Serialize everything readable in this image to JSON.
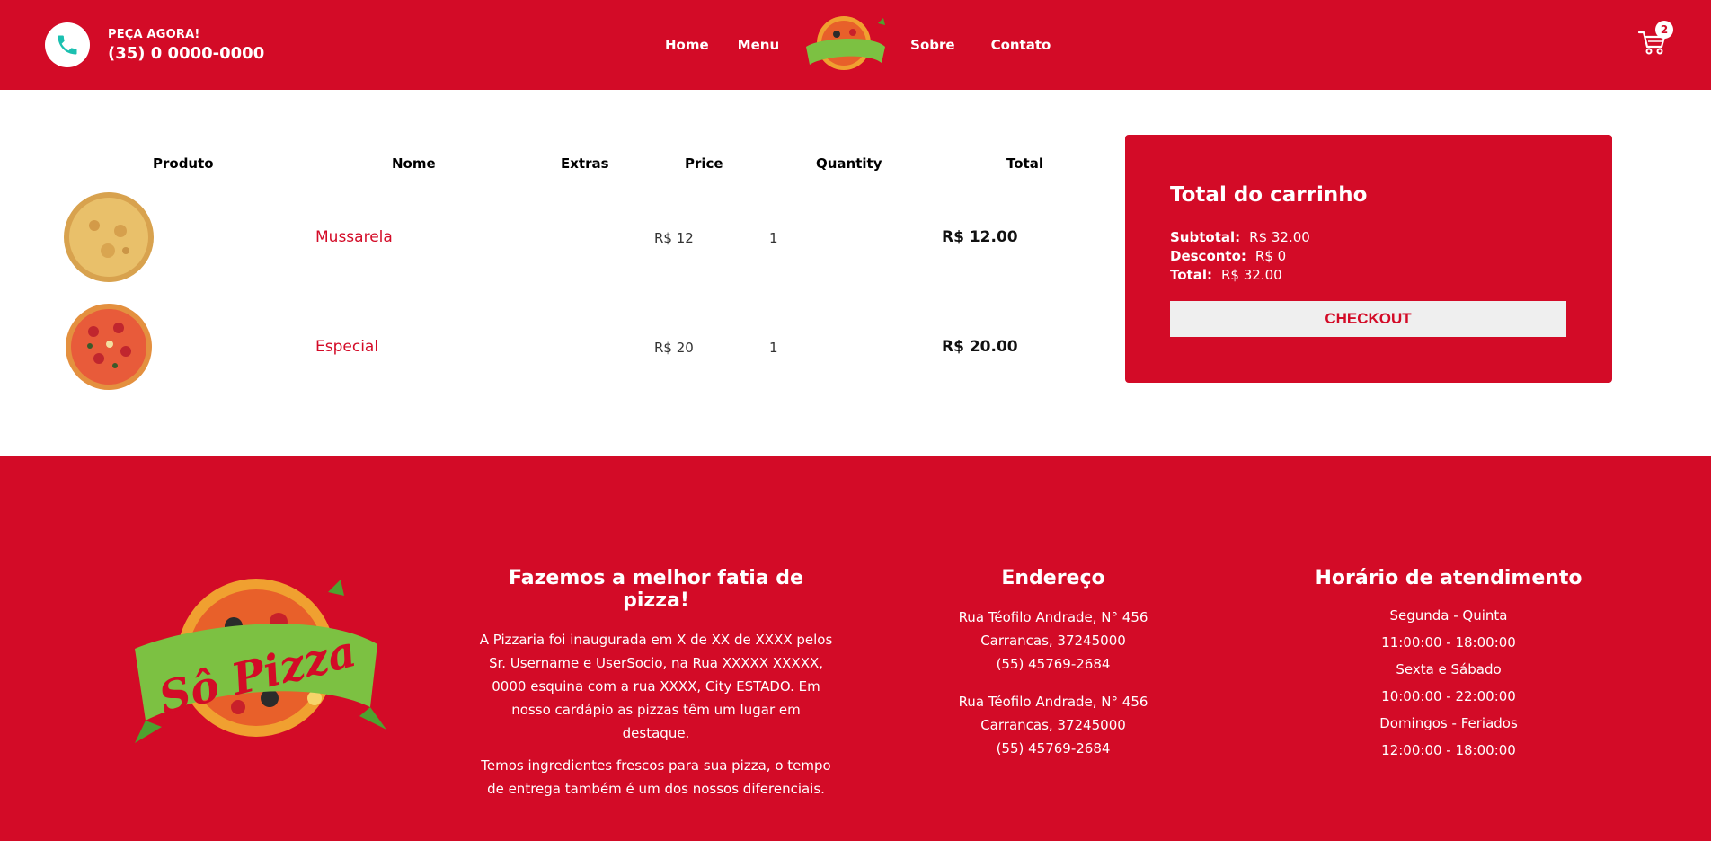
{
  "header": {
    "call_label": "PEÇA AGORA!",
    "call_number": "(35) 0 0000-0000",
    "nav": [
      "Home",
      "Menu",
      "Sobre",
      "Contato"
    ],
    "cart_count": "2"
  },
  "table": {
    "headers": [
      "Produto",
      "Nome",
      "Extras",
      "Price",
      "Quantity",
      "Total"
    ],
    "rows": [
      {
        "name": "Mussarela",
        "extras": "",
        "price": "R$ 12",
        "quantity": "1",
        "total": "R$ 12.00"
      },
      {
        "name": "Especial",
        "extras": "",
        "price": "R$ 20",
        "quantity": "1",
        "total": "R$ 20.00"
      }
    ]
  },
  "summary": {
    "title": "Total do carrinho",
    "subtotal_label": "Subtotal:",
    "subtotal": "R$ 32.00",
    "discount_label": "Desconto:",
    "discount": "R$ 0",
    "total_label": "Total:",
    "total": "R$ 32.00",
    "checkout": "CHECKOUT"
  },
  "footer": {
    "about_title": "Fazemos a melhor fatia de pizza!",
    "about_p1_l1": "A Pizzaria foi inaugurada em X de XX de XXXX pelos",
    "about_p1_l2": "Sr. Username e UserSocio, na Rua XXXXX XXXXX,",
    "about_p1_l3": "0000 esquina com a rua XXXX, City ESTADO. Em",
    "about_p1_l4": "nosso cardápio as pizzas têm um lugar em destaque.",
    "about_p2_l1": "Temos ingredientes frescos para sua pizza, o tempo",
    "about_p2_l2": "de entrega também é um dos nossos diferenciais.",
    "address_title": "Endereço",
    "address1_street": "Rua Téofilo Andrade, N° 456",
    "address1_city": "Carrancas, 37245000",
    "address1_phone": "(55) 45769-2684",
    "address2_street": "Rua Téofilo Andrade, N° 456",
    "address2_city": "Carrancas, 37245000",
    "address2_phone": "(55) 45769-2684",
    "hours_title": "Horário de atendimento",
    "hours": [
      "Segunda - Quinta",
      "11:00:00 - 18:00:00",
      "Sexta e Sábado",
      "10:00:00 - 22:00:00",
      "Domingos - Feriados",
      "12:00:00 - 18:00:00"
    ],
    "logo_text": "Sô Pizza"
  },
  "colors": {
    "brand_red": "#d30b27",
    "phone_icon": "#1bc0b0",
    "button_bg": "#efefef"
  },
  "icons": {
    "phone": "phone-icon",
    "cart": "cart-icon"
  }
}
